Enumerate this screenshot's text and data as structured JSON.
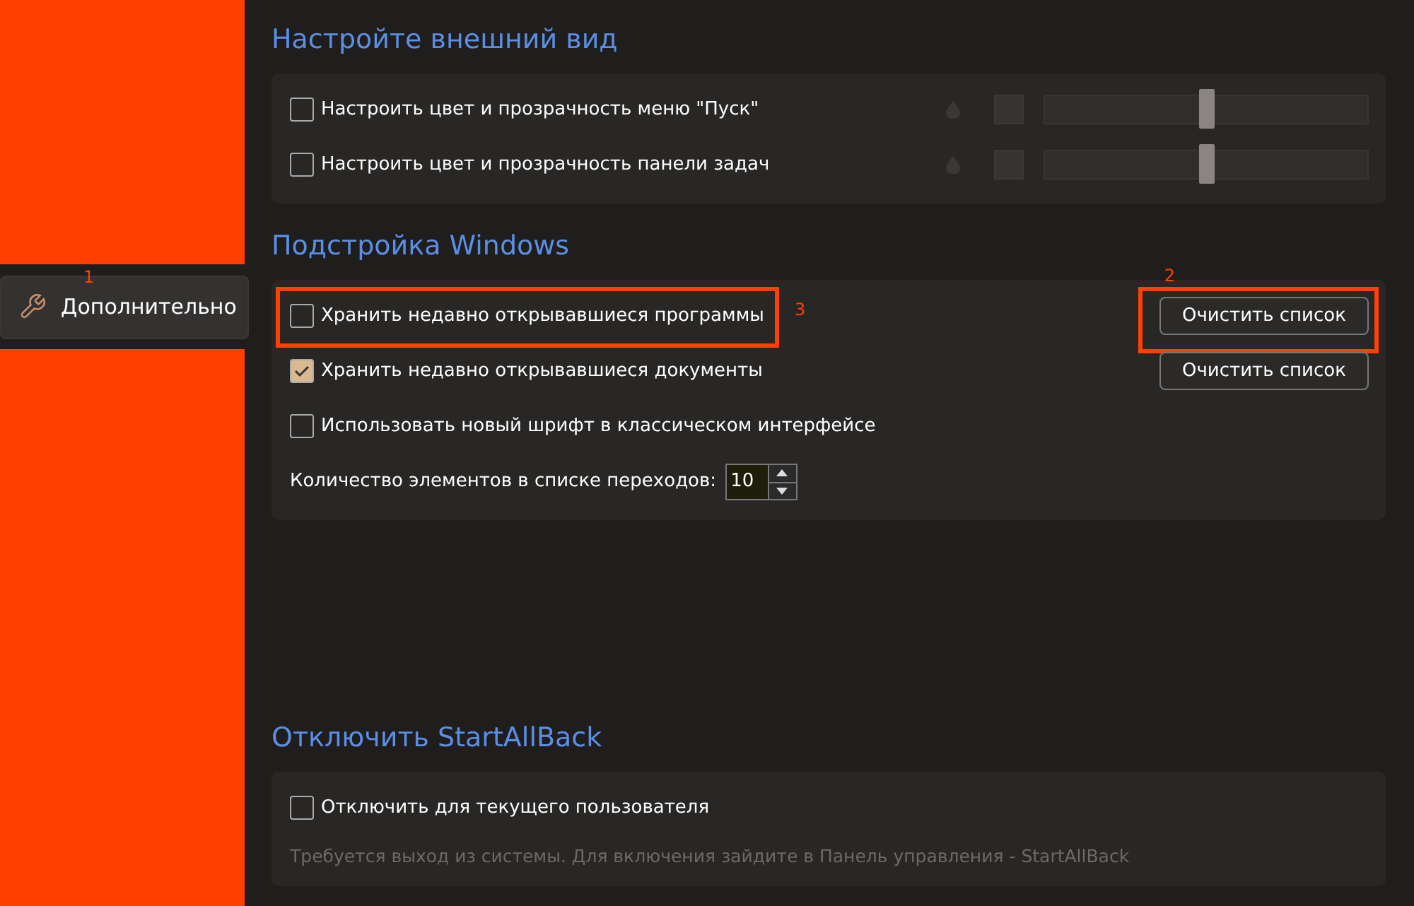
{
  "sidebar": {
    "items": [
      {
        "label": "Дополнительно",
        "selected": true
      }
    ]
  },
  "sections": [
    {
      "title": "Настройте внешний вид",
      "rows": [
        {
          "kind": "color",
          "label": "Настроить цвет и прозрачность меню \"Пуск\"",
          "checked": false,
          "level": 0.5
        },
        {
          "kind": "color",
          "label": "Настроить цвет и прозрачность панели задач",
          "checked": false,
          "level": 0.5
        }
      ]
    },
    {
      "title": "Подстройка Windows",
      "rows": [
        {
          "kind": "check",
          "label": "Хранить недавно открывавшиеся программы",
          "checked": false,
          "button": "Очистить список"
        },
        {
          "kind": "check",
          "label": "Хранить недавно открывавшиеся документы",
          "checked": true,
          "button": "Очистить список"
        },
        {
          "kind": "check",
          "label": "Использовать новый шрифт в классическом интерфейсе",
          "checked": false
        },
        {
          "kind": "spin",
          "label": "Количество элементов в списке переходов:",
          "value": "10"
        }
      ]
    },
    {
      "title": "Отключить StartAllBack",
      "rows": [
        {
          "kind": "check",
          "label": "Отключить для текущего пользователя",
          "checked": false
        },
        {
          "kind": "note",
          "label": "Требуется выход из системы. Для включения зайдите в Панель управления - StartAllBack"
        }
      ]
    }
  ],
  "annotations": [
    "1",
    "2",
    "3"
  ]
}
